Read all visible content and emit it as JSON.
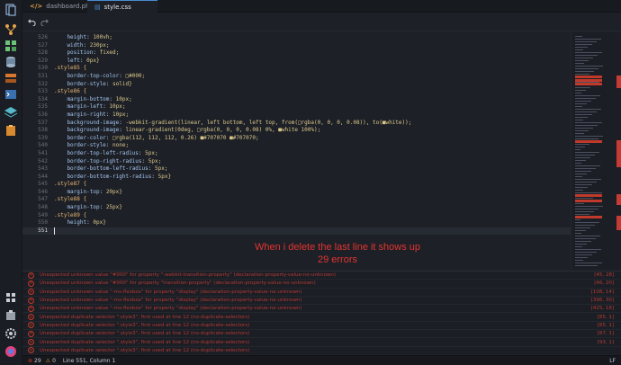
{
  "tabs": [
    {
      "label": "dashboard.php",
      "icon": "php-file-icon",
      "active": false
    },
    {
      "label": "style.css",
      "icon": "css-file-icon",
      "active": true
    }
  ],
  "editor": {
    "lines": [
      {
        "n": "526",
        "text": "    height: 100vh;"
      },
      {
        "n": "527",
        "text": "    width: 230px;"
      },
      {
        "n": "528",
        "text": "    position: fixed;"
      },
      {
        "n": "529",
        "text": "    left: 0px}"
      },
      {
        "n": "530",
        "text": ".style85 {"
      },
      {
        "n": "531",
        "text": "    border-top-color: □#000;"
      },
      {
        "n": "532",
        "text": "    border-style: solid}"
      },
      {
        "n": "533",
        "text": ".style86 {"
      },
      {
        "n": "534",
        "text": "    margin-bottom: 10px;"
      },
      {
        "n": "535",
        "text": "    margin-left: 10px;"
      },
      {
        "n": "536",
        "text": "    margin-right: 10px;"
      },
      {
        "n": "537",
        "text": "    background-image: -webkit-gradient(linear, left bottom, left top, from(□rgba(0, 0, 0, 0.08)), to(■white));"
      },
      {
        "n": "538",
        "text": "    background-image: linear-gradient(0deg, □rgba(0, 0, 0, 0.08) 0%, ■white 100%);"
      },
      {
        "n": "539",
        "text": "    border-color: □rgba(112, 112, 112, 0.26) ■#707070 ■#707070;"
      },
      {
        "n": "540",
        "text": "    border-style: none;"
      },
      {
        "n": "541",
        "text": "    border-top-left-radius: 5px;"
      },
      {
        "n": "542",
        "text": "    border-top-right-radius: 5px;"
      },
      {
        "n": "543",
        "text": "    border-bottom-left-radius: 5px;"
      },
      {
        "n": "544",
        "text": "    border-bottom-right-radius: 5px}"
      },
      {
        "n": "545",
        "text": ".style87 {"
      },
      {
        "n": "546",
        "text": "    margin-top: 20px}"
      },
      {
        "n": "547",
        "text": ".style88 {"
      },
      {
        "n": "548",
        "text": "    margin-top: 25px}"
      },
      {
        "n": "549",
        "text": ".style89 {"
      },
      {
        "n": "550",
        "text": "    height: 0px}"
      },
      {
        "n": "551",
        "text": ""
      }
    ],
    "current_line": "551"
  },
  "note": "When i delete the last line it shows up 29 errors",
  "problems": [
    {
      "msg": "Unexpected unknown value \"#000\" for property \"-webkit-transition-property\" (declaration-property-value-no-unknown)",
      "loc": "[45, 28]"
    },
    {
      "msg": "Unexpected unknown value \"#000\" for property \"transition-property\" (declaration-property-value-no-unknown)",
      "loc": "[46, 20]"
    },
    {
      "msg": "Unexpected unknown value \"-ms-flexbox\" for property \"display\" (declaration-property-value-no-unknown)",
      "loc": "[108, 14]"
    },
    {
      "msg": "Unexpected unknown value \"-ms-flexbox\" for property \"display\" (declaration-property-value-no-unknown)",
      "loc": "[396, 30]"
    },
    {
      "msg": "Unexpected unknown value \"-ms-flexbox\" for property \"display\" (declaration-property-value-no-unknown)",
      "loc": "[425, 18]"
    },
    {
      "msg": "Unexpected duplicate selector \".style3\", first used at line 12 (no-duplicate-selectors)",
      "loc": "[85, 1]"
    },
    {
      "msg": "Unexpected duplicate selector \".style3\", first used at line 12 (no-duplicate-selectors)",
      "loc": "[85, 1]"
    },
    {
      "msg": "Unexpected duplicate selector \".style3\", first used at line 12 (no-duplicate-selectors)",
      "loc": "[87, 1]"
    },
    {
      "msg": "Unexpected duplicate selector \".style3\", first used at line 12 (no-duplicate-selectors)",
      "loc": "[93, 1]"
    },
    {
      "msg": "Unexpected duplicate selector \".style3\", first used at line 12 (no-duplicate-selectors)",
      "loc": ""
    }
  ],
  "status": {
    "errors": "29",
    "warnings": "0",
    "position": "Line 551, Column 1",
    "eol": "LF"
  },
  "colors": {
    "error": "#c0392b",
    "accent": "#4b8bd0",
    "note": "#e3342f"
  }
}
